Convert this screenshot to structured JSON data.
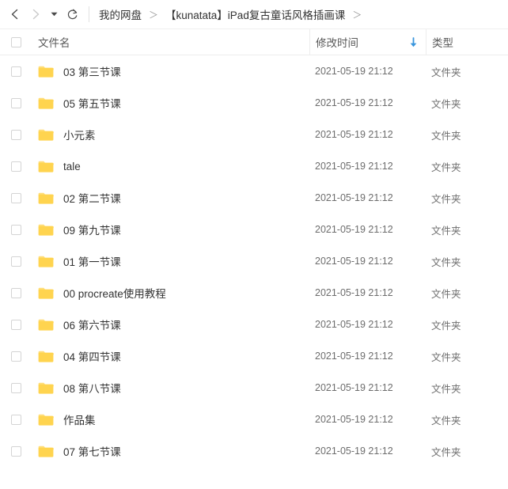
{
  "toolbar": {
    "back_icon": "chevron-left-icon",
    "forward_icon": "chevron-right-icon",
    "history_caret_icon": "caret-down-icon",
    "refresh_icon": "refresh-icon",
    "breadcrumb": {
      "items": [
        {
          "label": "我的网盘"
        },
        {
          "label": "【kunatata】iPad复古童话风格插画课"
        }
      ],
      "separator": "＞"
    }
  },
  "list": {
    "columns": {
      "name": "文件名",
      "time": "修改时间",
      "type": "类型"
    },
    "sort": {
      "column": "修改时间",
      "direction": "descending",
      "icon": "arrow-down-icon",
      "color": "#3a96dd"
    },
    "select_all_checked": false,
    "rows": [
      {
        "name": "03 第三节课",
        "time": "2021-05-19 21:12",
        "type": "文件夹",
        "icon": "folder-icon"
      },
      {
        "name": "05 第五节课",
        "time": "2021-05-19 21:12",
        "type": "文件夹",
        "icon": "folder-icon"
      },
      {
        "name": "小元素",
        "time": "2021-05-19 21:12",
        "type": "文件夹",
        "icon": "folder-icon"
      },
      {
        "name": "tale",
        "time": "2021-05-19 21:12",
        "type": "文件夹",
        "icon": "folder-icon"
      },
      {
        "name": "02 第二节课",
        "time": "2021-05-19 21:12",
        "type": "文件夹",
        "icon": "folder-icon"
      },
      {
        "name": "09 第九节课",
        "time": "2021-05-19 21:12",
        "type": "文件夹",
        "icon": "folder-icon"
      },
      {
        "name": "01 第一节课",
        "time": "2021-05-19 21:12",
        "type": "文件夹",
        "icon": "folder-icon"
      },
      {
        "name": "00 procreate使用教程",
        "time": "2021-05-19 21:12",
        "type": "文件夹",
        "icon": "folder-icon"
      },
      {
        "name": "06 第六节课",
        "time": "2021-05-19 21:12",
        "type": "文件夹",
        "icon": "folder-icon"
      },
      {
        "name": "04 第四节课",
        "time": "2021-05-19 21:12",
        "type": "文件夹",
        "icon": "folder-icon"
      },
      {
        "name": "08 第八节课",
        "time": "2021-05-19 21:12",
        "type": "文件夹",
        "icon": "folder-icon"
      },
      {
        "name": "作品集",
        "time": "2021-05-19 21:12",
        "type": "文件夹",
        "icon": "folder-icon"
      },
      {
        "name": "07 第七节课",
        "time": "2021-05-19 21:12",
        "type": "文件夹",
        "icon": "folder-icon"
      }
    ]
  },
  "colors": {
    "folder": "#ffd44f",
    "folder_tab": "#ffde7a",
    "sort_blue": "#3a96dd",
    "text_primary": "#333333",
    "text_secondary": "#6d6d6d",
    "border": "#ededed"
  }
}
